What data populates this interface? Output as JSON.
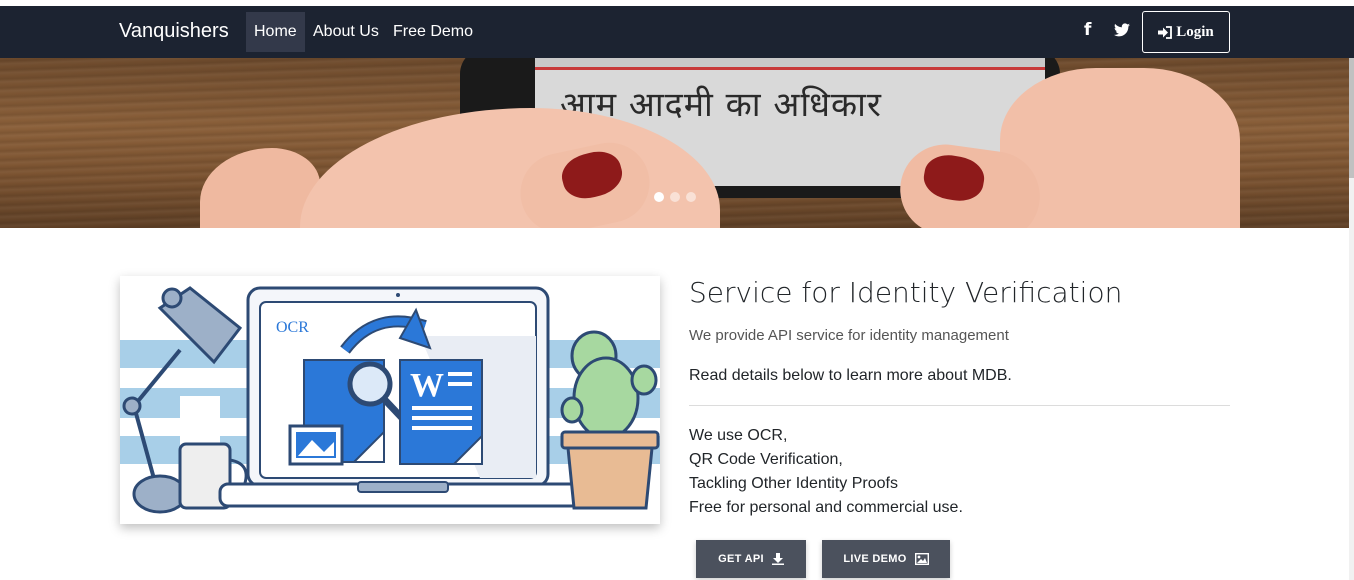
{
  "navbar": {
    "brand": "Vanquishers",
    "links": [
      {
        "label": "Home",
        "active": true
      },
      {
        "label": "About Us",
        "active": false
      },
      {
        "label": "Free Demo",
        "active": false
      }
    ],
    "social_icons": [
      "facebook-icon",
      "twitter-icon"
    ],
    "login_label": "Login",
    "login_icon": "sign-in-icon",
    "background": "#1c2331"
  },
  "carousel": {
    "image_text": "आम आदमी का अधिकार",
    "indicators": 3,
    "active_index": 0
  },
  "illustration": {
    "ocr_label": "OCR",
    "doc_letter": "W"
  },
  "content": {
    "title": "Service for Identity Verification",
    "lead": "We provide API service for identity management",
    "description": "Read details below to learn more about MDB.",
    "features": [
      "We use OCR,",
      "QR Code Verification,",
      "Tackling Other Identity Proofs",
      "Free for personal and commercial use."
    ],
    "buttons": [
      {
        "label": "GET API",
        "icon": "download-icon"
      },
      {
        "label": "LIVE DEMO",
        "icon": "image-icon"
      }
    ]
  },
  "colors": {
    "button_bg": "#4b515d",
    "accent_blue": "#2b78d8"
  }
}
